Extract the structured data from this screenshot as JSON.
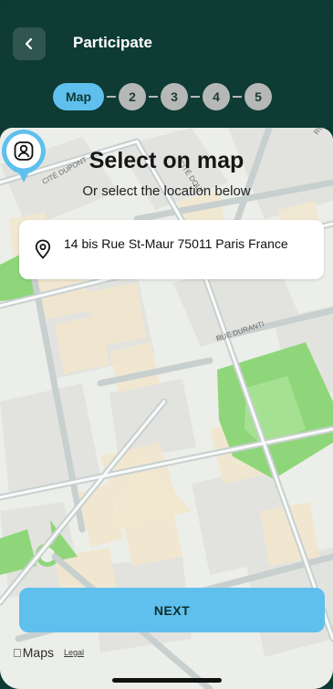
{
  "header": {
    "title": "Participate",
    "back_icon": "chevron-left-icon"
  },
  "stepper": {
    "steps": [
      "Map",
      "2",
      "3",
      "4",
      "5"
    ],
    "active_index": 0
  },
  "map": {
    "heading": "Select on map",
    "subheading": "Or select the location below",
    "street_labels": [
      "CITÉ DUPONT",
      "CITÉ DOLY",
      "RUE DURANTI",
      "RU"
    ],
    "attribution": "Maps",
    "legal": "Legal"
  },
  "address": {
    "text": "14 bis Rue St-Maur 75011 Paris France",
    "icon": "location-pin-icon"
  },
  "marker": {
    "icon": "user-location-icon"
  },
  "actions": {
    "next_label": "NEXT"
  },
  "colors": {
    "header_bg": "#0e3b33",
    "accent": "#5fc0ee",
    "step_inactive": "#b5b8b7",
    "park_green": "#8fd67a"
  }
}
